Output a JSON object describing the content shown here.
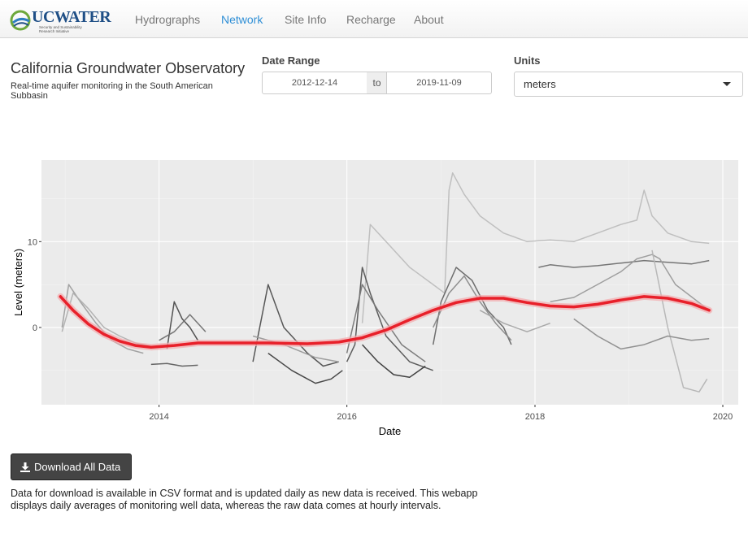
{
  "nav": {
    "logo": "UCWATER",
    "logo_sub": "Security and Sustainability Research Initiative",
    "items": [
      {
        "label": "Hydrographs",
        "active": false
      },
      {
        "label": "Network",
        "active": true
      },
      {
        "label": "Site Info",
        "active": false
      },
      {
        "label": "Recharge",
        "active": false
      },
      {
        "label": "About",
        "active": false
      }
    ]
  },
  "header": {
    "title": "California Groundwater Observatory",
    "subtitle": "Real-time aquifer monitoring in the South American Subbasin"
  },
  "date_range": {
    "label": "Date Range",
    "start": "2012-12-14",
    "separator": "to",
    "end": "2019-11-09"
  },
  "units": {
    "label": "Units",
    "value": "meters"
  },
  "colors": {
    "accent": "#2f8fd6",
    "trend": "#e8202a",
    "panel": "#ebebeb",
    "button": "#444444"
  },
  "chart_data": {
    "type": "line",
    "xlabel": "Date",
    "ylabel": "Level (meters)",
    "xlim": [
      "2012-10-01",
      "2020-03-01"
    ],
    "ylim": [
      -9,
      19.5
    ],
    "x_ticks": [
      "2014",
      "2016",
      "2018",
      "2020"
    ],
    "y_ticks": [
      0,
      10
    ],
    "grid": true,
    "legend": "none",
    "trend_series": {
      "color": "#e8202a",
      "x": [
        "2012-12-14",
        "2013-02-01",
        "2013-04-01",
        "2013-06-01",
        "2013-08-01",
        "2013-10-01",
        "2013-12-01",
        "2014-03-01",
        "2014-06-01",
        "2014-10-01",
        "2015-03-01",
        "2015-08-01",
        "2015-12-01",
        "2016-03-01",
        "2016-06-01",
        "2016-09-01",
        "2016-12-01",
        "2017-03-01",
        "2017-06-01",
        "2017-09-01",
        "2017-12-01",
        "2018-03-01",
        "2018-06-01",
        "2018-09-01",
        "2018-12-01",
        "2019-03-01",
        "2019-06-01",
        "2019-09-01",
        "2019-11-09"
      ],
      "y": [
        3.6,
        2.0,
        0.4,
        -0.8,
        -1.6,
        -2.1,
        -2.3,
        -2.1,
        -1.8,
        -1.8,
        -1.8,
        -1.9,
        -1.7,
        -1.2,
        -0.3,
        0.9,
        2.0,
        2.9,
        3.4,
        3.4,
        2.9,
        2.5,
        2.4,
        2.7,
        3.2,
        3.6,
        3.4,
        2.8,
        2.0
      ]
    },
    "well_series": [
      {
        "color": "#bdbdbd",
        "x": [
          "2016-03-01",
          "2016-04-01",
          "2016-06-01",
          "2016-09-01",
          "2016-12-01",
          "2017-01-15",
          "2017-02-01",
          "2017-02-15",
          "2017-04-01",
          "2017-06-01",
          "2017-09-01",
          "2017-12-01",
          "2018-03-01",
          "2018-06-01",
          "2018-09-01",
          "2018-12-01",
          "2019-02-01",
          "2019-03-01",
          "2019-04-01",
          "2019-06-01",
          "2019-09-01",
          "2019-11-09"
        ],
        "y": [
          0.5,
          12.0,
          10.0,
          7.0,
          5.0,
          4.0,
          16.0,
          18.0,
          15.5,
          13.0,
          11.0,
          10.0,
          10.2,
          10.0,
          11.0,
          12.0,
          12.5,
          16.0,
          13.0,
          11.0,
          10.0,
          9.8
        ]
      },
      {
        "color": "#9e9e9e",
        "x": [
          "2012-12-20",
          "2013-01-15",
          "2013-03-01",
          "2013-05-01",
          "2013-07-01",
          "2013-09-01",
          "2013-11-01"
        ],
        "y": [
          0.0,
          5.0,
          3.0,
          0.5,
          -1.5,
          -2.5,
          -3.0
        ]
      },
      {
        "color": "#b0b0b0",
        "x": [
          "2012-12-20",
          "2013-02-01",
          "2013-04-01",
          "2013-06-01",
          "2013-08-01",
          "2013-10-01",
          "2013-12-01"
        ],
        "y": [
          -0.5,
          4.0,
          2.2,
          0.0,
          -1.0,
          -1.8,
          -2.2
        ]
      },
      {
        "color": "#5e5e5e",
        "x": [
          "2013-12-01",
          "2014-02-01",
          "2014-04-01",
          "2014-06-01"
        ],
        "y": [
          -4.3,
          -4.2,
          -4.5,
          -4.4
        ]
      },
      {
        "color": "#4a4a4a",
        "x": [
          "2014-02-01",
          "2014-03-01",
          "2014-04-01",
          "2014-05-01",
          "2014-06-01"
        ],
        "y": [
          -2.5,
          3.0,
          1.0,
          0.0,
          -1.5
        ]
      },
      {
        "color": "#707070",
        "x": [
          "2014-01-01",
          "2014-03-01",
          "2014-05-01",
          "2014-07-01"
        ],
        "y": [
          -1.5,
          -0.5,
          1.5,
          -0.5
        ]
      },
      {
        "color": "#4f4f4f",
        "x": [
          "2015-01-01",
          "2015-03-01",
          "2015-05-01",
          "2015-08-01",
          "2015-10-01",
          "2015-12-01"
        ],
        "y": [
          -4.0,
          5.0,
          0.0,
          -3.0,
          -4.5,
          -4.0
        ]
      },
      {
        "color": "#3f3f3f",
        "x": [
          "2015-03-01",
          "2015-06-01",
          "2015-09-01",
          "2015-11-01",
          "2015-12-15"
        ],
        "y": [
          -3.0,
          -5.0,
          -6.5,
          -6.0,
          -5.0
        ]
      },
      {
        "color": "#9a9a9a",
        "x": [
          "2015-01-01",
          "2015-05-01",
          "2015-09-01",
          "2015-12-01"
        ],
        "y": [
          -1.0,
          -2.0,
          -3.5,
          -4.0
        ]
      },
      {
        "color": "#555555",
        "x": [
          "2016-01-01",
          "2016-02-01",
          "2016-03-01",
          "2016-04-01",
          "2016-06-01",
          "2016-09-01",
          "2016-12-01"
        ],
        "y": [
          -4.0,
          -2.0,
          7.0,
          4.0,
          -1.0,
          -4.0,
          -5.0
        ]
      },
      {
        "color": "#777777",
        "x": [
          "2016-01-01",
          "2016-03-01",
          "2016-05-01",
          "2016-08-01",
          "2016-11-01"
        ],
        "y": [
          -3.0,
          5.0,
          2.0,
          -2.0,
          -4.0
        ]
      },
      {
        "color": "#383838",
        "x": [
          "2016-03-01",
          "2016-05-01",
          "2016-07-01",
          "2016-09-01",
          "2016-11-01"
        ],
        "y": [
          -2.0,
          -4.0,
          -5.5,
          -5.8,
          -4.5
        ]
      },
      {
        "color": "#666666",
        "x": [
          "2016-12-01",
          "2017-01-01",
          "2017-03-01",
          "2017-05-01",
          "2017-07-01",
          "2017-09-01",
          "2017-10-01"
        ],
        "y": [
          -2.0,
          3.0,
          7.0,
          5.5,
          2.0,
          0.0,
          -2.0
        ]
      },
      {
        "color": "#8a8a8a",
        "x": [
          "2016-12-01",
          "2017-02-01",
          "2017-04-01",
          "2017-06-01",
          "2017-08-01",
          "2017-10-01"
        ],
        "y": [
          0.0,
          4.0,
          6.0,
          3.0,
          0.5,
          -1.5
        ]
      },
      {
        "color": "#a5a5a5",
        "x": [
          "2017-06-01",
          "2017-09-01",
          "2017-12-01",
          "2018-03-01"
        ],
        "y": [
          2.0,
          0.5,
          -0.5,
          0.5
        ]
      },
      {
        "color": "#6f6f6f",
        "x": [
          "2018-01-15",
          "2018-03-01",
          "2018-06-01",
          "2018-09-01",
          "2018-12-01",
          "2019-03-01",
          "2019-06-01",
          "2019-09-01",
          "2019-11-09"
        ],
        "y": [
          7.0,
          7.3,
          7.0,
          7.2,
          7.5,
          7.8,
          7.6,
          7.4,
          7.8
        ]
      },
      {
        "color": "#9a9a9a",
        "x": [
          "2018-03-01",
          "2018-06-01",
          "2018-09-01",
          "2018-12-01",
          "2019-02-01",
          "2019-04-01",
          "2019-05-01",
          "2019-07-01",
          "2019-11-09"
        ],
        "y": [
          3.0,
          3.5,
          5.0,
          6.5,
          8.0,
          8.5,
          8.0,
          5.0,
          2.0
        ]
      },
      {
        "color": "#b5b5b5",
        "x": [
          "2019-04-01",
          "2019-06-01",
          "2019-08-01",
          "2019-10-01",
          "2019-11-01"
        ],
        "y": [
          9.0,
          0.0,
          -7.0,
          -7.5,
          -6.0
        ]
      },
      {
        "color": "#8c8c8c",
        "x": [
          "2018-06-01",
          "2018-09-01",
          "2018-12-01",
          "2019-03-01",
          "2019-06-01",
          "2019-09-01",
          "2019-11-09"
        ],
        "y": [
          1.0,
          -1.0,
          -2.5,
          -2.0,
          -1.0,
          -1.5,
          -1.3
        ]
      }
    ]
  },
  "download": {
    "label": "Download All Data"
  },
  "note": "Data for download is available in CSV format and is updated daily as new data is received. This webapp displays daily averages of monitoring well data, whereas the raw data comes at hourly intervals."
}
